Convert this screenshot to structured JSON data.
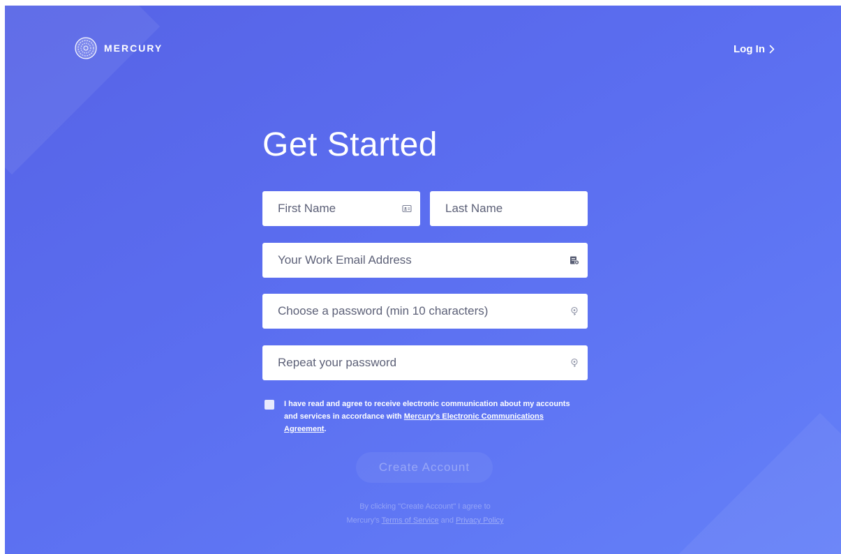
{
  "brand": {
    "name": "MERCURY",
    "logo_icon": "mercury-logo"
  },
  "nav": {
    "login_label": "Log In",
    "login_icon": "chevron-right-icon"
  },
  "form": {
    "title": "Get Started",
    "first_name_placeholder": "First Name",
    "last_name_placeholder": "Last Name",
    "email_placeholder": "Your Work Email Address",
    "password_placeholder": "Choose a password (min 10 characters)",
    "repeat_password_placeholder": "Repeat your password",
    "consent": {
      "checked": false,
      "text_before": "I have read and agree to receive electronic communication about my accounts and services in accordance with ",
      "link_text": "Mercury's Electronic Communications Agreement",
      "text_after": "."
    },
    "submit_label": "Create Account",
    "legal": {
      "text_before": "By clicking \"Create Account\" I agree to",
      "text_mid": "Mercury's",
      "terms_label": "Terms of Service",
      "and": "and",
      "privacy_label": "Privacy Policy"
    }
  },
  "colors": {
    "background_start": "#5663e6",
    "background_end": "#6480f8",
    "field_background": "#ffffff",
    "placeholder": "#5c6077"
  }
}
